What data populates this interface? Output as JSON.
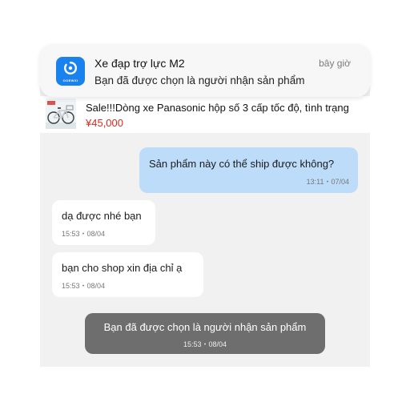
{
  "notification": {
    "app_icon": "order-app-icon",
    "app_icon_label": "OOEWXI",
    "title": "Xe đạp trợ lực M2",
    "time": "bây giờ",
    "body": "Bạn đã được chọn là người nhận sản phẩm"
  },
  "product": {
    "thumbnail": "bicycle-image",
    "name": "Sale!!!Dòng xe Panasonic hộp số 3 cấp tốc độ, tình trạng",
    "price": "¥45,000"
  },
  "messages": [
    {
      "direction": "outgoing",
      "text": "Sản phẩm này có thể ship được không?",
      "time": "13:11・07/04"
    },
    {
      "direction": "incoming",
      "text": "dạ được nhé bạn",
      "time": "15:53・08/04"
    },
    {
      "direction": "incoming",
      "text": "bạn cho shop xin địa chỉ ạ",
      "time": "15:53・08/04"
    }
  ],
  "system_message": {
    "text": "Bạn đã được chọn là người nhận sản phẩm",
    "time": "15:53・08/04"
  },
  "colors": {
    "accent": "#1a82ee",
    "price": "#e0281c",
    "outgoing_bubble": "#bcdcfa",
    "system_bubble": "#6e6e6e",
    "chat_background": "#f1f1f1"
  }
}
